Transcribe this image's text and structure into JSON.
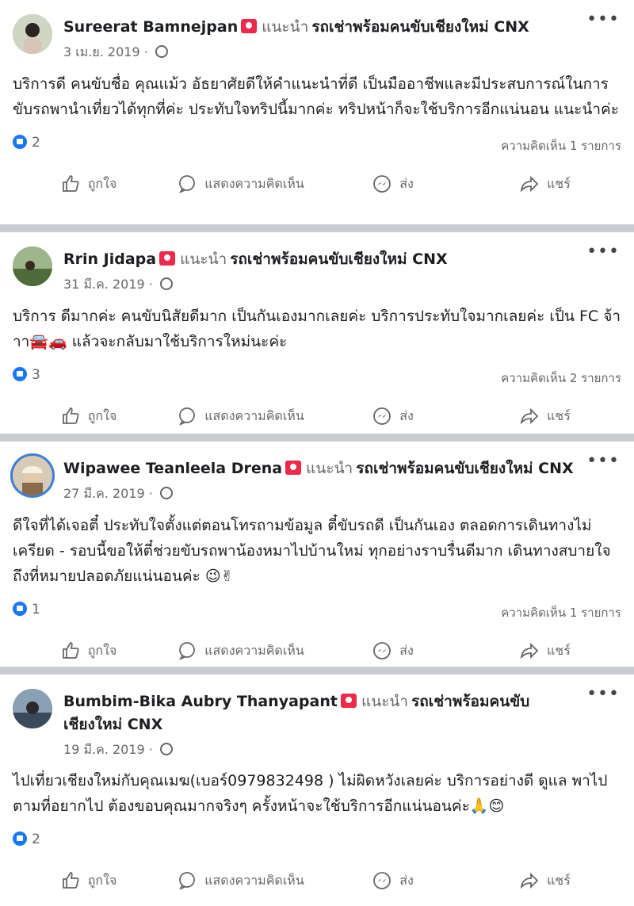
{
  "posts": [
    {
      "name": "Sureerat Bamnejpan",
      "recommend": "แนะนำ",
      "page": "รถเช่าพร้อมคนขับเชียงใหม่ CNX",
      "date": "3 เม.ย. 2019",
      "body": "บริการดี คนขับชื่อ คุณแม้ว อัธยาศัยดีให้คำแนะนำที่ดี เป็นมืออาชีพและมีประสบการณ์ในการขับรถพานำเที่ยวได้ทุกที่ค่ะ ประทับใจทริปนี้มากค่ะ ทริปหน้าก็จะใช้บริการอีกแน่นอน แนะนำค่ะ",
      "likes": "2",
      "comments": "ความคิดเห็น 1 รายการ"
    },
    {
      "name": "Rrin Jidapa",
      "recommend": "แนะนำ",
      "page": "รถเช่าพร้อมคนขับเชียงใหม่ CNX",
      "date": "31 มี.ค. 2019",
      "body": "บริการ ดีมากค่ะ คนขับนิสัยดีมาก เป็นกันเองมากเลยค่ะ บริการประทับใจมากเลยค่ะ เป็น FC จ้าาา🚘🚗 แล้วจะกลับมาใช้บริการใหม่นะค่ะ",
      "likes": "3",
      "comments": "ความคิดเห็น 2 รายการ"
    },
    {
      "name": "Wipawee Teanleela Drena",
      "recommend": "แนะนำ",
      "page": "รถเช่าพร้อมคนขับเชียงใหม่ CNX",
      "date": "27 มี.ค. 2019",
      "body": "ดีใจที่ได้เจอตี๋ ประทับใจตั้งแต่ตอนโทรถามข้อมูล ตี๋ขับรถดี เป็นกันเอง ตลอดการเดินทางไม่เครียด - รอบนี้ขอให้ตี๋ช่วยขับรถพาน้องหมาไปบ้านใหม่ ทุกอย่างราบรื่นดีมาก เดินทางสบายใจ ถึงที่หมายปลอดภัยแน่นอนค่ะ 😉✌",
      "likes": "1",
      "comments": "ความคิดเห็น 1 รายการ"
    },
    {
      "name": "Bumbim-Bika Aubry Thanyapant",
      "recommend": "แนะนำ",
      "page": "รถเช่าพร้อมคนขับเชียงใหม่ CNX",
      "date": "19 มี.ค. 2019",
      "body": "ไปเที่ยวเชียงใหม่กับคุณเมฆ(เบอร์0979832498 ) ไม่ผิดหวังเลยค่ะ บริการอย่างดี ดูแล พาไปตามที่อยากไป ต้องขอบคุณมากจริงๆ ครั้งหน้าจะใช้บริการอีกแน่นอนค่ะ🙏😊",
      "likes": "2",
      "comments": ""
    }
  ],
  "actions": {
    "like": "ถูกใจ",
    "comment": "แสดงความคิดเห็น",
    "send": "ส่ง",
    "share": "แชร์"
  },
  "more_icon": "more-dots-icon"
}
